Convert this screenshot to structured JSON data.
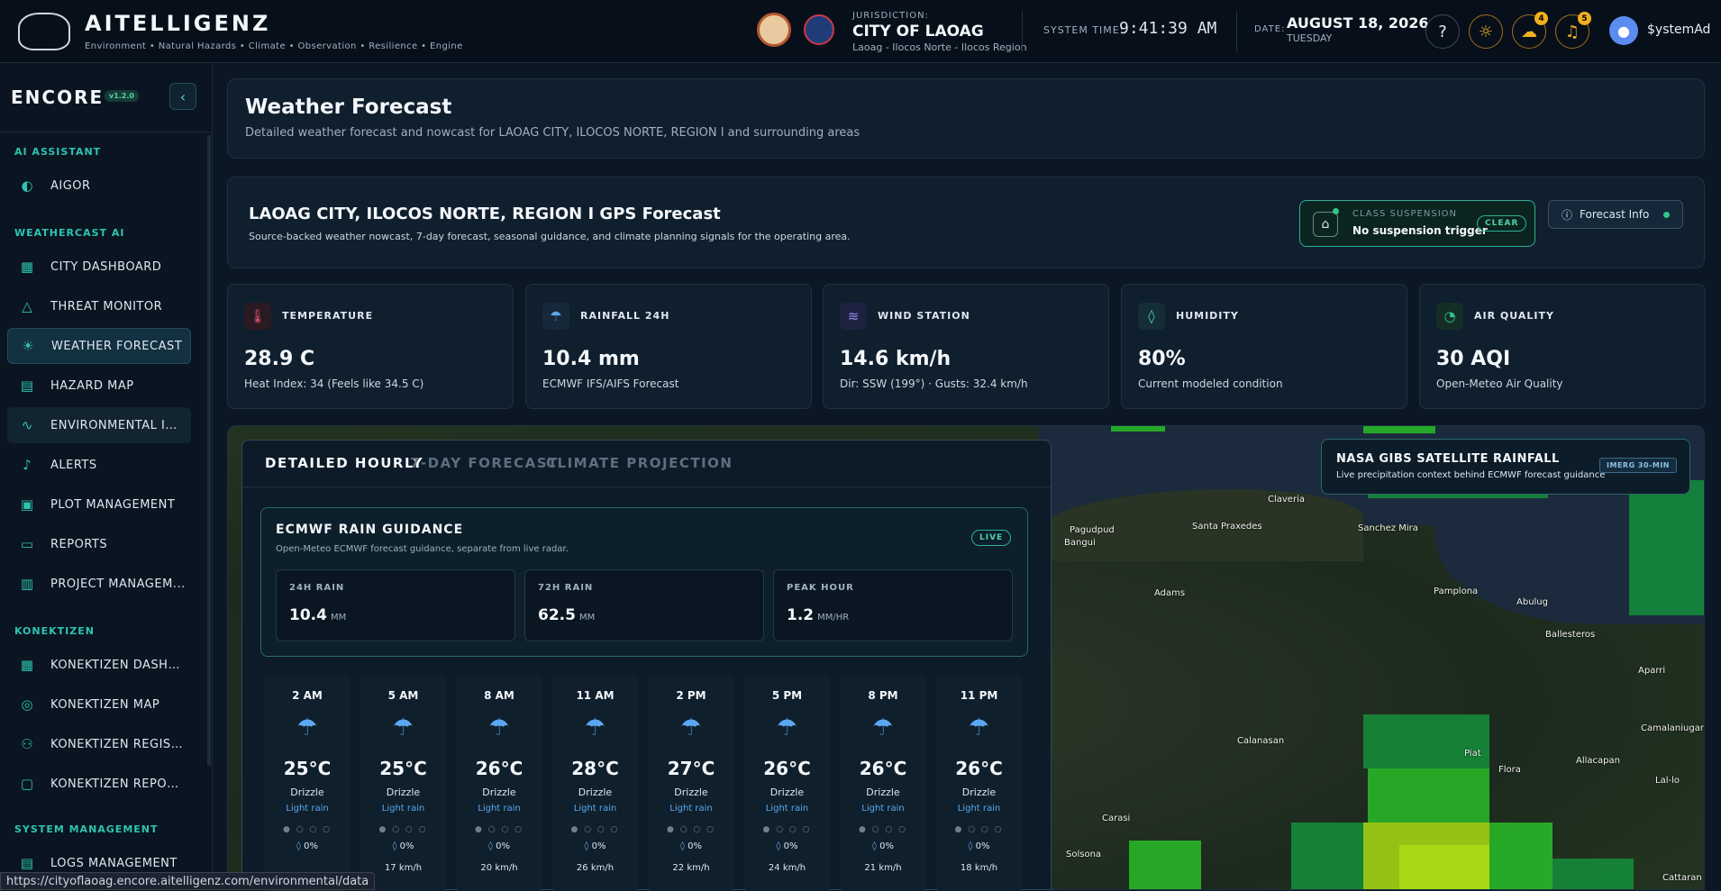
{
  "header": {
    "brand": "AITELLIGENZ",
    "tagline": "Environment • Natural Hazards • Climate • Observation • Resilience • Engine",
    "jurisdiction_label": "JURISDICTION:",
    "jurisdiction_name": "CITY OF LAOAG",
    "jurisdiction_sub": "Laoag - Ilocos Norte - Ilocos Region",
    "system_time_label": "SYSTEM TIME:",
    "system_time": "9:41:39 AM",
    "date_label": "DATE:",
    "date": "AUGUST 18, 2026",
    "day": "TUESDAY",
    "weather_badge": "4",
    "bell_badge": "5",
    "user": "$ystemAd",
    "icons": [
      "help-icon",
      "sun-icon",
      "rain-cloud-icon",
      "bell-icon",
      "user-icon"
    ]
  },
  "sidebar": {
    "logo": "ENCORE",
    "version": "v1.2.0",
    "sections": [
      {
        "title": "AI ASSISTANT",
        "items": [
          {
            "label": "AIGOR",
            "icon": "ai-icon"
          }
        ]
      },
      {
        "title": "WEATHERCAST AI",
        "items": [
          {
            "label": "CITY DASHBOARD",
            "icon": "dashboard-icon"
          },
          {
            "label": "THREAT MONITOR",
            "icon": "warning-icon"
          },
          {
            "label": "WEATHER FORECAST",
            "icon": "weather-icon",
            "active": true
          },
          {
            "label": "HAZARD MAP",
            "icon": "map-icon"
          },
          {
            "label": "ENVIRONMENTAL IN...",
            "icon": "activity-icon"
          },
          {
            "label": "ALERTS",
            "icon": "bell-icon"
          },
          {
            "label": "PLOT MANAGEMENT",
            "icon": "clipboard-icon"
          },
          {
            "label": "REPORTS",
            "icon": "report-icon"
          },
          {
            "label": "PROJECT MANAGEM...",
            "icon": "briefcase-icon"
          }
        ]
      },
      {
        "title": "KONEKTIZEN",
        "items": [
          {
            "label": "KONEKTIZEN DASHB...",
            "icon": "dashboard-icon"
          },
          {
            "label": "KONEKTIZEN MAP",
            "icon": "map-pin-icon"
          },
          {
            "label": "KONEKTIZEN REGIST...",
            "icon": "user-plus-icon"
          },
          {
            "label": "KONEKTIZEN REPORTS",
            "icon": "message-icon"
          }
        ]
      },
      {
        "title": "SYSTEM MANAGEMENT",
        "items": [
          {
            "label": "LOGS MANAGEMENT",
            "icon": "logs-icon"
          }
        ]
      }
    ],
    "status_url": "https://cityoflaoag.encore.aitelligenz.com/environmental/data"
  },
  "page": {
    "title": "Weather Forecast",
    "subtitle": "Detailed weather forecast and nowcast for LAOAG CITY, ILOCOS NORTE, REGION I and surrounding areas",
    "gps_title": "LAOAG CITY, ILOCOS NORTE, REGION I GPS Forecast",
    "gps_subtitle": "Source-backed weather nowcast, 7-day forecast, seasonal guidance, and climate planning signals for the operating area.",
    "class_suspension_label": "CLASS SUSPENSION",
    "class_suspension_value": "No suspension trigger",
    "clear": "CLEAR",
    "forecast_info": "Forecast Info"
  },
  "metrics": [
    {
      "label": "TEMPERATURE",
      "value": "28.9 C",
      "sub": "Heat Index: 34 (Feels like 34.5 C)",
      "icon": "thermometer-icon",
      "color": "#e0556a"
    },
    {
      "label": "RAINFALL 24H",
      "value": "10.4 mm",
      "sub": "ECMWF IFS/AIFS Forecast",
      "icon": "rain-icon",
      "color": "#5aa8f0"
    },
    {
      "label": "WIND STATION",
      "value": "14.6 km/h",
      "sub": "Dir: SSW (199°) · Gusts: 32.4 km/h",
      "icon": "wind-icon",
      "color": "#8f8ff0"
    },
    {
      "label": "HUMIDITY",
      "value": "80%",
      "sub": "Current modeled condition",
      "icon": "droplet-icon",
      "color": "#4fd3c8"
    },
    {
      "label": "AIR QUALITY",
      "value": "30 AQI",
      "sub": "Open-Meteo Air Quality",
      "icon": "gauge-icon",
      "color": "#2ec48a"
    }
  ],
  "forecast_panel": {
    "tabs": [
      "DETAILED HOURLY",
      "7-DAY FORECAST",
      "CLIMATE PROJECTION"
    ],
    "rain_guidance": {
      "title": "ECMWF RAIN GUIDANCE",
      "subtitle": "Open-Meteo ECMWF forecast guidance, separate from live radar.",
      "live": "LIVE",
      "stats": [
        {
          "label": "24H RAIN",
          "value": "10.4",
          "unit": "MM"
        },
        {
          "label": "72H RAIN",
          "value": "62.5",
          "unit": "MM"
        },
        {
          "label": "PEAK HOUR",
          "value": "1.2",
          "unit": "MM/HR"
        }
      ]
    },
    "hourly": [
      {
        "time": "2 AM",
        "temp": "25°C",
        "cond": "Drizzle",
        "rain": "Light rain",
        "prob": "0%",
        "wind": ""
      },
      {
        "time": "5 AM",
        "temp": "25°C",
        "cond": "Drizzle",
        "rain": "Light rain",
        "prob": "0%",
        "wind": "17 km/h"
      },
      {
        "time": "8 AM",
        "temp": "26°C",
        "cond": "Drizzle",
        "rain": "Light rain",
        "prob": "0%",
        "wind": "20 km/h"
      },
      {
        "time": "11 AM",
        "temp": "28°C",
        "cond": "Drizzle",
        "rain": "Light rain",
        "prob": "0%",
        "wind": "26 km/h"
      },
      {
        "time": "2 PM",
        "temp": "27°C",
        "cond": "Drizzle",
        "rain": "Light rain",
        "prob": "0%",
        "wind": "22 km/h"
      },
      {
        "time": "5 PM",
        "temp": "26°C",
        "cond": "Drizzle",
        "rain": "Light rain",
        "prob": "0%",
        "wind": "24 km/h"
      },
      {
        "time": "8 PM",
        "temp": "26°C",
        "cond": "Drizzle",
        "rain": "Light rain",
        "prob": "0%",
        "wind": "21 km/h"
      },
      {
        "time": "11 PM",
        "temp": "26°C",
        "cond": "Drizzle",
        "rain": "Light rain",
        "prob": "0%",
        "wind": "18 km/h"
      }
    ]
  },
  "map": {
    "sat_title": "NASA GIBS SATELLITE RAINFALL",
    "sat_sub": "Live precipitation context behind ECMWF forecast guidance",
    "sat_tag": "IMERG 30-MIN",
    "towns": [
      "Pagudpud",
      "Bangui",
      "Claveria",
      "Santa Praxedes",
      "Sanchez Mira",
      "Adams",
      "Pamplona",
      "Abulug",
      "Ballesteros",
      "Aparri",
      "Calanasan",
      "Piat",
      "Flora",
      "Allacapan",
      "Camalaniugan",
      "Lal-lo",
      "Carasi",
      "Solsona",
      "Cattaran"
    ]
  }
}
